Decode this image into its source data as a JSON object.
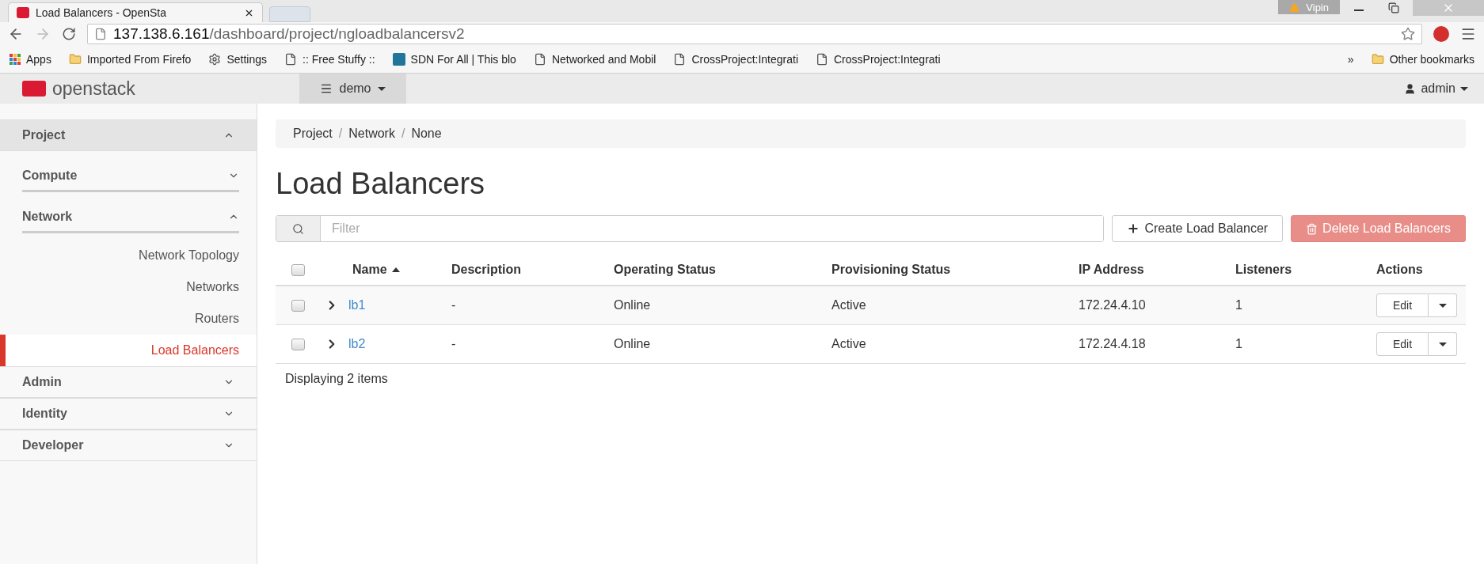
{
  "browser": {
    "tab_title": "Load Balancers - OpenSta",
    "profile": "Vipin",
    "url_host": "137.138.6.161",
    "url_path": "/dashboard/project/ngloadbalancersv2",
    "bookmarks": [
      {
        "kind": "apps",
        "label": "Apps"
      },
      {
        "kind": "folder",
        "label": "Imported From Firefo"
      },
      {
        "kind": "gear",
        "label": "Settings"
      },
      {
        "kind": "page",
        "label": ":: Free Stuffy ::"
      },
      {
        "kind": "wp",
        "label": "SDN For All | This blo"
      },
      {
        "kind": "page",
        "label": "Networked and Mobil"
      },
      {
        "kind": "page",
        "label": "CrossProject:Integrati"
      },
      {
        "kind": "page",
        "label": "CrossProject:Integrati"
      }
    ],
    "overflow": "»",
    "other_bookmarks": "Other bookmarks"
  },
  "header": {
    "logo": "openstack",
    "project": "demo",
    "user": "admin"
  },
  "sidebar": [
    {
      "label": "Project",
      "expanded": true,
      "children": [
        {
          "label": "Compute",
          "expanded": false
        },
        {
          "label": "Network",
          "expanded": true,
          "children": [
            {
              "label": "Network Topology",
              "selected": false
            },
            {
              "label": "Networks",
              "selected": false
            },
            {
              "label": "Routers",
              "selected": false
            },
            {
              "label": "Load Balancers",
              "selected": true
            }
          ]
        }
      ]
    },
    {
      "label": "Admin",
      "expanded": false
    },
    {
      "label": "Identity",
      "expanded": false
    },
    {
      "label": "Developer",
      "expanded": false
    }
  ],
  "breadcrumb": [
    "Project",
    "Network",
    "None"
  ],
  "breadcrumb_separator": "/",
  "title": "Load Balancers",
  "filter": {
    "placeholder": "Filter"
  },
  "buttons": {
    "create": "Create Load Balancer",
    "delete": "Delete Load Balancers",
    "delete_disabled": true
  },
  "table": {
    "all_checked": false,
    "columns": [
      "Name",
      "Description",
      "Operating Status",
      "Provisioning Status",
      "IP Address",
      "Listeners",
      "Actions"
    ],
    "rows": [
      {
        "checked": false,
        "name": "lb1",
        "description": "-",
        "operating_status": "Online",
        "provisioning_status": "Active",
        "ip": "172.24.4.10",
        "listeners": "1",
        "action": "Edit"
      },
      {
        "checked": false,
        "name": "lb2",
        "description": "-",
        "operating_status": "Online",
        "provisioning_status": "Active",
        "ip": "172.24.4.18",
        "listeners": "1",
        "action": "Edit"
      }
    ]
  },
  "footer": "Displaying 2 items"
}
